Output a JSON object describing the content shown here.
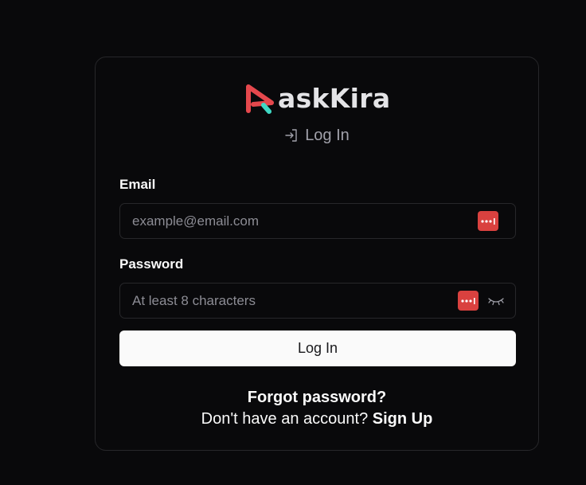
{
  "brand": {
    "name": "askKira",
    "logo_colors": {
      "primary": "#e5484d",
      "accent": "#3fd8c4"
    }
  },
  "form": {
    "title": "Log In",
    "email": {
      "label": "Email",
      "placeholder": "example@email.com",
      "value": ""
    },
    "password": {
      "label": "Password",
      "placeholder": "At least 8 characters",
      "value": ""
    },
    "submit_label": "Log In",
    "forgot_label": "Forgot password?",
    "signup_prompt": "Don't have an account?",
    "signup_label": "Sign Up"
  },
  "icons": {
    "title": "log-in-icon",
    "password_manager": "password-manager-icon",
    "toggle_visibility": "eye-closed-icon"
  },
  "colors": {
    "background": "#09090b",
    "border": "#27272a",
    "button_bg": "#fafafa",
    "password_manager": "#d9413f"
  }
}
